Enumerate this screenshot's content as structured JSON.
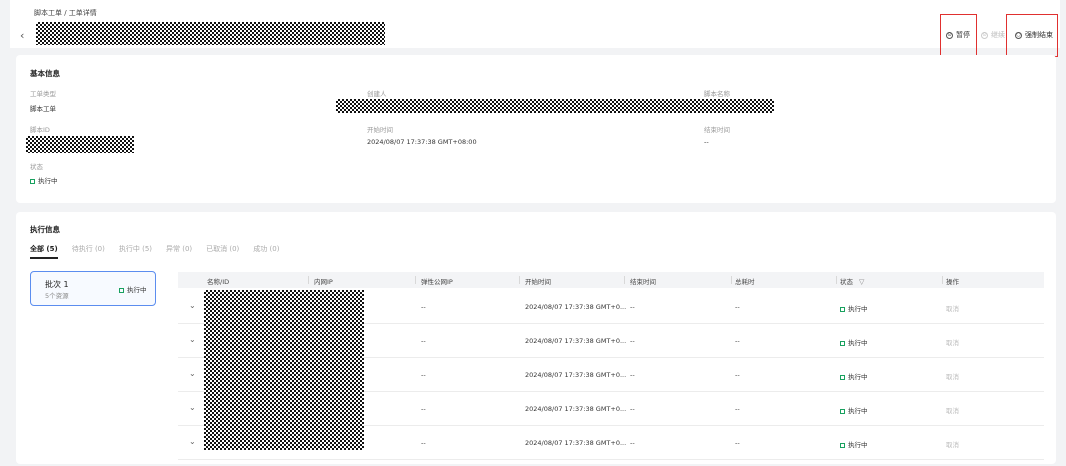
{
  "header": {
    "breadcrumb": "脚本工单 / 工单详情",
    "back_icon": "‹",
    "actions": [
      {
        "label": "暂停",
        "icon": "⊙",
        "enabled": true,
        "highlighted": true
      },
      {
        "label": "继续",
        "icon": "⊙",
        "enabled": false,
        "highlighted": false
      },
      {
        "label": "强制结束",
        "icon": "○",
        "enabled": true,
        "highlighted": true
      }
    ]
  },
  "basic_info": {
    "title": "基本信息",
    "order_type_label": "工单类型",
    "order_type_value": "脚本工单",
    "creator_label": "创建人",
    "script_name_label": "脚本名称",
    "script_id_label": "脚本ID",
    "start_time_label": "开始时间",
    "start_time_value": "2024/08/07 17:37:38 GMT+08:00",
    "end_time_label": "结束时间",
    "end_time_value": "--",
    "status_label": "状态",
    "status_value": "执行中",
    "status_color": "#19a15f"
  },
  "exec_info": {
    "title": "执行信息",
    "tabs": [
      "全部 (5)",
      "待执行 (0)",
      "执行中 (5)",
      "异常 (0)",
      "已取消 (0)",
      "成功 (0)"
    ],
    "active_tab": 0,
    "batch": {
      "name": "批次 1",
      "count": "5个资源",
      "status": "执行中"
    },
    "columns": [
      "名称/ID",
      "内网IP",
      "弹性公网IP",
      "开始时间",
      "结束时间",
      "总耗时",
      "状态",
      "操作"
    ],
    "rows": [
      {
        "eip": "--",
        "start": "2024/08/07 17:37:38 GMT+0...",
        "end": "--",
        "duration": "--",
        "status": "执行中",
        "action": "取消"
      },
      {
        "eip": "--",
        "start": "2024/08/07 17:37:38 GMT+0...",
        "end": "--",
        "duration": "--",
        "status": "执行中",
        "action": "取消"
      },
      {
        "eip": "--",
        "start": "2024/08/07 17:37:38 GMT+0...",
        "end": "--",
        "duration": "--",
        "status": "执行中",
        "action": "取消"
      },
      {
        "eip": "--",
        "start": "2024/08/07 17:37:38 GMT+0...",
        "end": "--",
        "duration": "--",
        "status": "执行中",
        "action": "取消"
      },
      {
        "eip": "--",
        "start": "2024/08/07 17:37:38 GMT+0...",
        "end": "--",
        "duration": "--",
        "status": "执行中",
        "action": "取消"
      }
    ]
  },
  "icons": {
    "expand": "chevron-down-icon",
    "filter": "filter-icon",
    "status": "status-square-icon"
  },
  "colors": {
    "highlight": "#e0302f",
    "batch_border": "#5b8def",
    "running": "#19a15f"
  }
}
